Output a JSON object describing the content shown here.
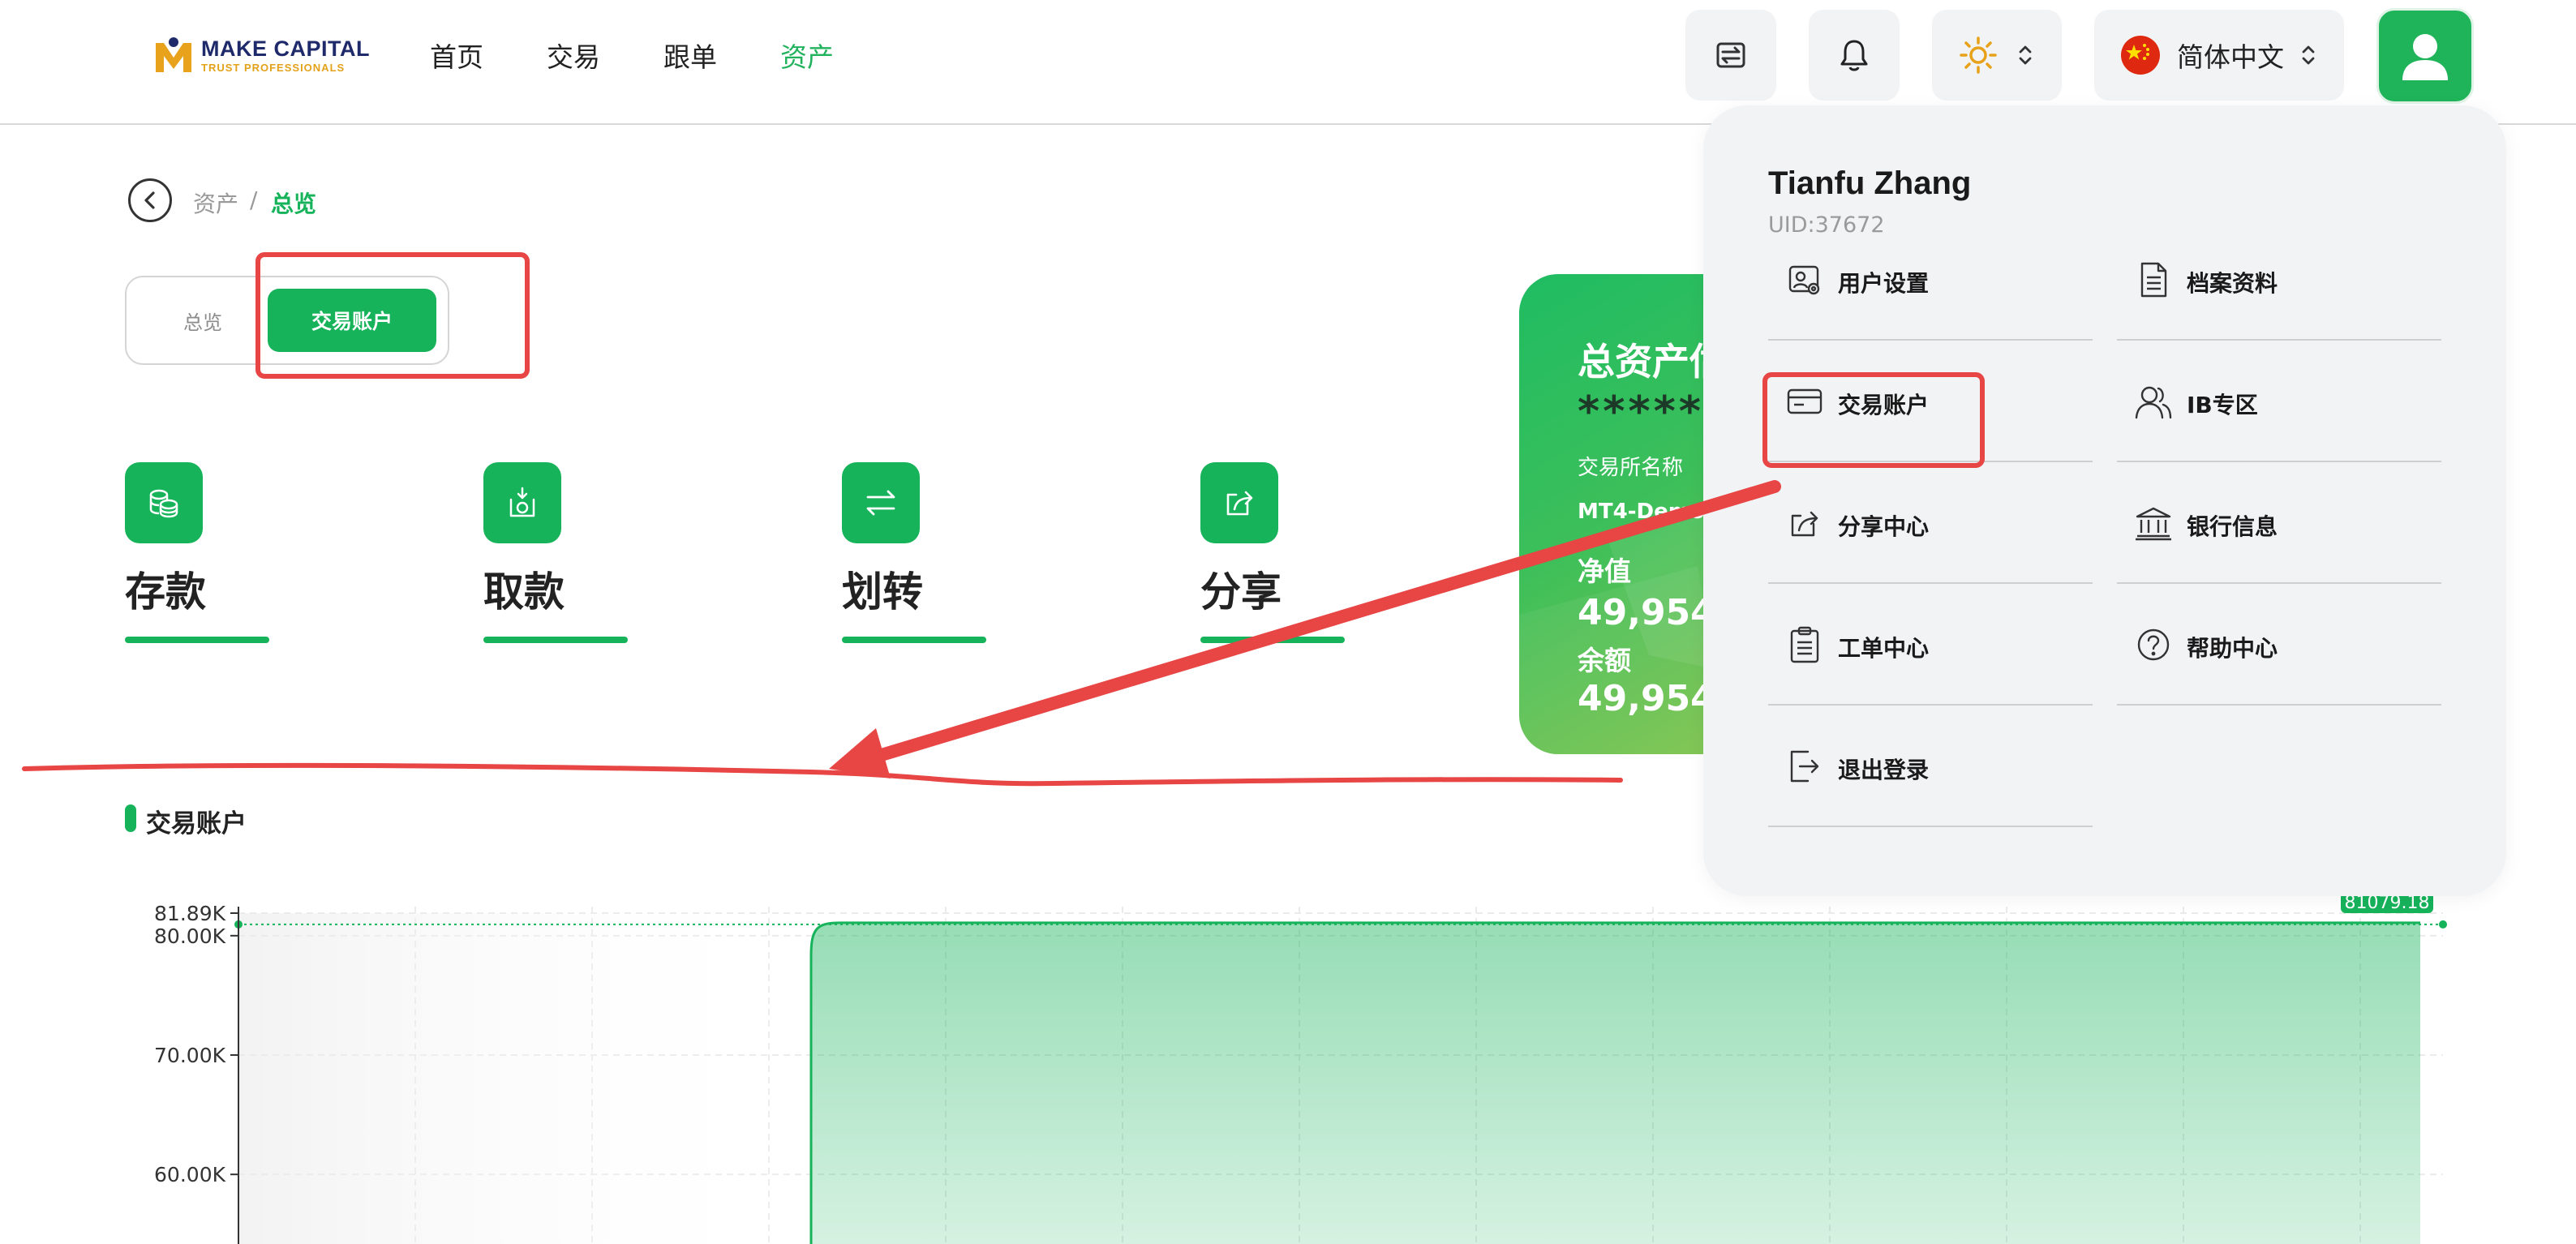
{
  "brand": {
    "name": "MAKE CAPITAL",
    "tagline": "TRUST PROFESSIONALS"
  },
  "nav": [
    {
      "label": "首页",
      "active": false
    },
    {
      "label": "交易",
      "active": false
    },
    {
      "label": "跟单",
      "active": false
    },
    {
      "label": "资产",
      "active": true
    }
  ],
  "header": {
    "language_label": "简体中文"
  },
  "breadcrumb": {
    "parent": "资产",
    "separator": "/",
    "current": "总览"
  },
  "tabs": {
    "overview": "总览",
    "trading_account": "交易账户"
  },
  "actions": [
    {
      "label": "存款",
      "icon": "coins-icon"
    },
    {
      "label": "取款",
      "icon": "withdraw-icon"
    },
    {
      "label": "划转",
      "icon": "transfer-icon"
    },
    {
      "label": "分享",
      "icon": "share-icon"
    }
  ],
  "asset_card": {
    "title": "总资产估",
    "masked_value": "*****",
    "exchange_label": "交易所名称",
    "server": "MT4-Demo",
    "equity_label": "净值",
    "equity_value": "49,954.",
    "balance_label": "余额",
    "balance_value": "49,954."
  },
  "section": {
    "title": "交易账户"
  },
  "user_menu": {
    "name": "Tianfu Zhang",
    "uid": "UID:37672",
    "items": [
      {
        "label": "用户设置",
        "icon": "user-settings-icon"
      },
      {
        "label": "档案资料",
        "icon": "document-icon"
      },
      {
        "label": "交易账户",
        "icon": "card-icon"
      },
      {
        "label": "IB专区",
        "icon": "users-icon"
      },
      {
        "label": "分享中心",
        "icon": "share-icon"
      },
      {
        "label": "银行信息",
        "icon": "bank-icon"
      },
      {
        "label": "工单中心",
        "icon": "clipboard-icon"
      },
      {
        "label": "帮助中心",
        "icon": "help-icon"
      },
      {
        "label": "退出登录",
        "icon": "logout-icon"
      }
    ]
  },
  "colors": {
    "accent": "#16b35b",
    "annotation": "#e84545"
  },
  "chart_data": {
    "type": "area",
    "y_ticks": [
      "81.89K",
      "80.00K",
      "70.00K",
      "60.00K"
    ],
    "tick_values": [
      81890,
      80000,
      70000,
      60000
    ],
    "ylim": [
      50000,
      81890
    ],
    "plateau_value": 81079.18,
    "plateau_label": "81079.18",
    "grid": true
  }
}
